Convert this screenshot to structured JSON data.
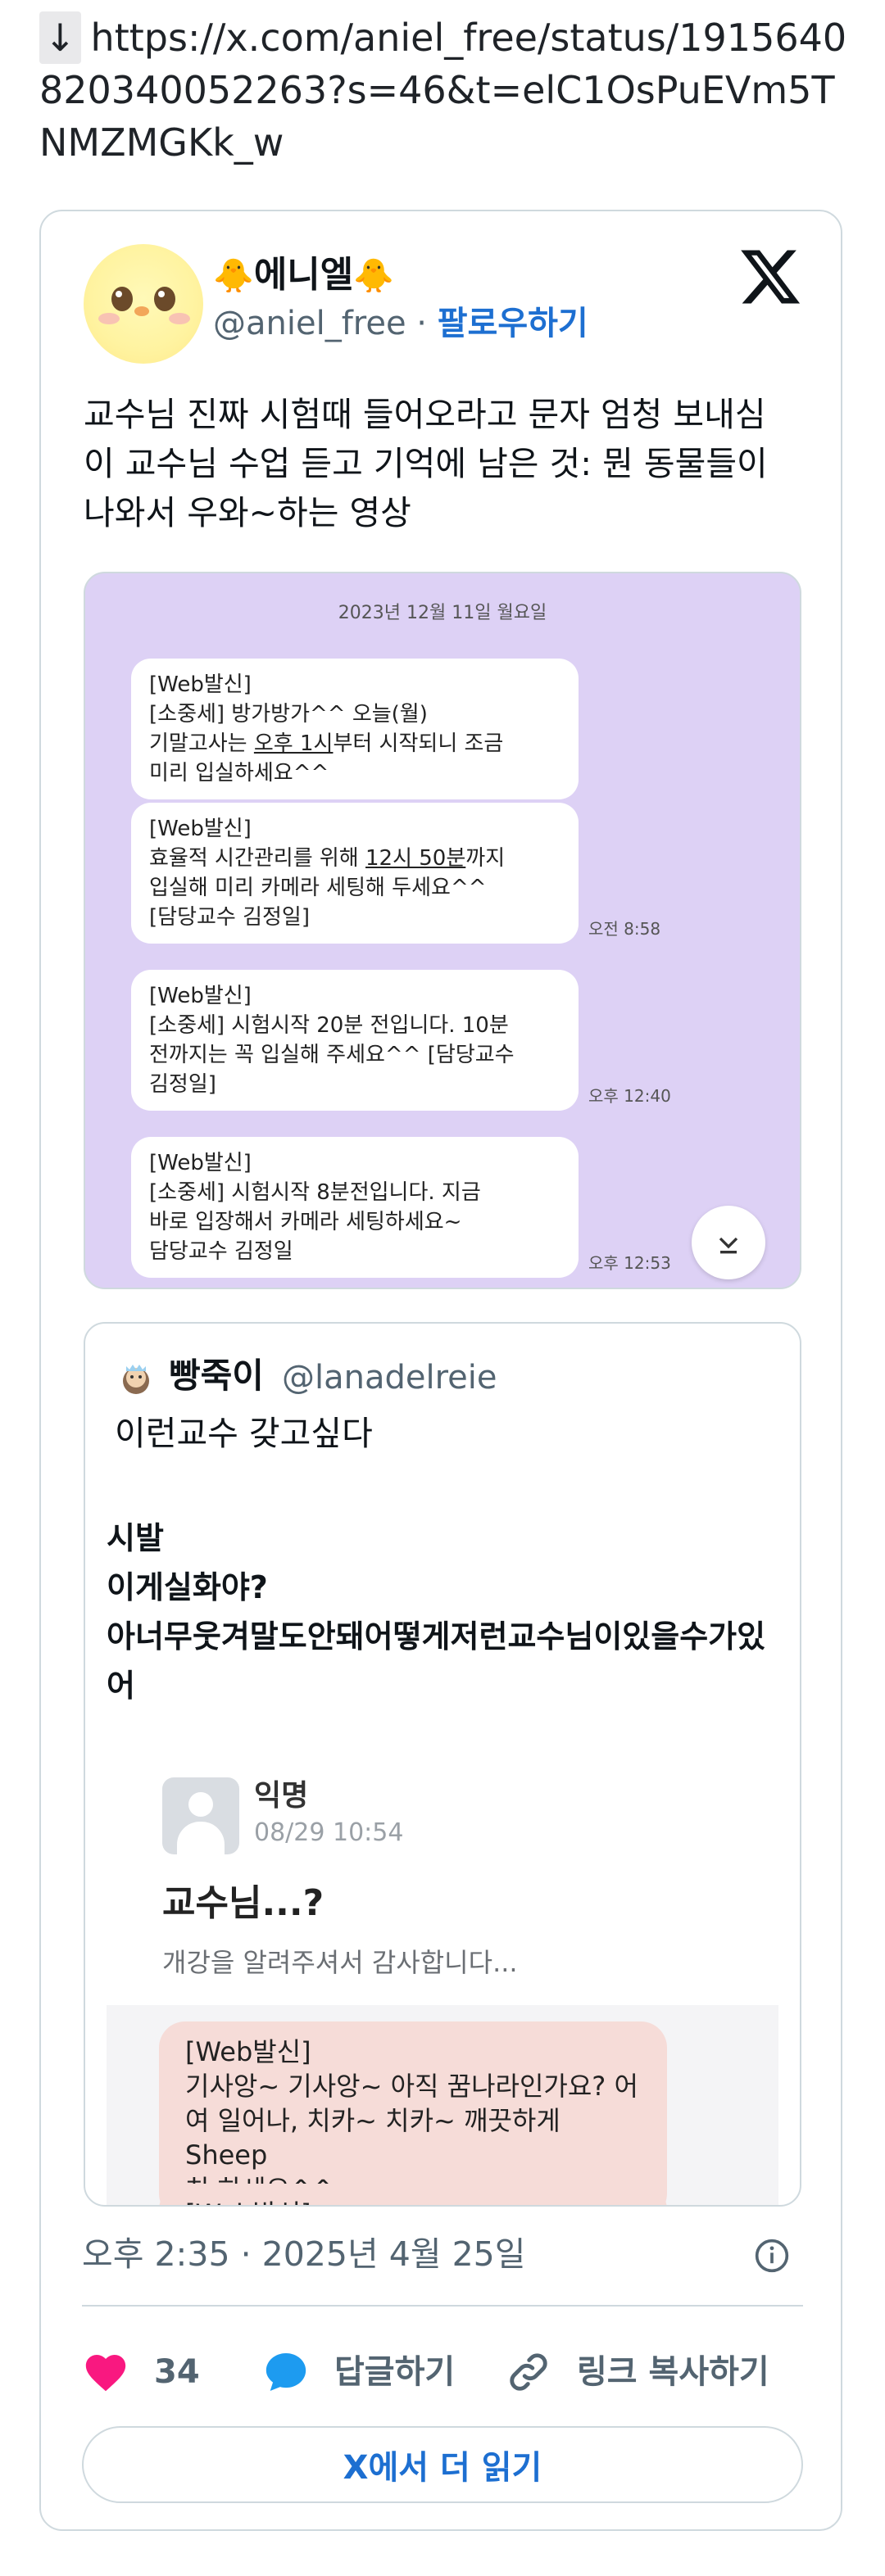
{
  "link": {
    "arrow": "↓",
    "url": "https://x.com/aniel_free/status/1915640820340052263?s=46&t=elC1OsPuEVm5TNMZMGKk_w"
  },
  "tweet": {
    "author": {
      "emoji_left": "🐥",
      "display_name": "에니엘",
      "emoji_right": "🐥",
      "handle": "@aniel_free",
      "separator": "·",
      "follow_label": "팔로우하기"
    },
    "text": "교수님 진짜 시험때 들어오라고 문자 엄청 보내심 이 교수님 수업 듣고 기억에 남은 것: 뭔 동물들이 나와서 우와~하는 영상",
    "media": {
      "date_header": "2023년 12월 11일 월요일",
      "messages": [
        {
          "l1": "[Web발신]",
          "l2": "[소중세]  방가방가^^ 오늘(월)",
          "l3a": "기말고사는 ",
          "l3u": "오후 1시",
          "l3b": "부터 시작되니 조금",
          "l4": "미리 입실하세요^^",
          "time": ""
        },
        {
          "l1": "[Web발신]",
          "l2a": "효율적 시간관리를 위해 ",
          "l2u": "12시 50분",
          "l2b": "까지",
          "l3": "입실해 미리 카메라 세팅해 두세요^^",
          "l4": "[담당교수 김정일]",
          "time": "오전 8:58"
        },
        {
          "l1": "[Web발신]",
          "l2": "[소중세] 시험시작 20분 전입니다. 10분",
          "l3": "전까지는 꼭 입실해 주세요^^ [담당교수",
          "l4": "김정일]",
          "time": "오후 12:40"
        },
        {
          "l1": "[Web발신]",
          "l2": "[소중세] 시험시작 8분전입니다. 지금",
          "l3": "바로 입장해서 카메라 세팅하세요~",
          "l4": "담당교수 김정일",
          "time": "오후 12:53"
        }
      ]
    },
    "quote": {
      "name": "빵죽이",
      "handle": "@lanadelreie",
      "text": "이런교수 갖고싶다",
      "bold_lines": [
        "시발",
        "이게실화야?",
        "아너무웃겨말도안돼어떻게저런교수님이있을수가있",
        "어"
      ],
      "screenshot": {
        "user": "익명",
        "time": "08/29 10:54",
        "title": "교수님...?",
        "subtitle": "개강을 알려주셔서 감사합니다...",
        "chat": [
          {
            "l1": "[Web발신]",
            "l2": "기사앙~ 기사앙~ 아직 꿈나라인가요? 어",
            "l3": "여 일어나, 치카~ 치카~ 깨끗하게 Sheep",
            "l4": "치 하세요^^"
          },
          {
            "l1": "[Web발신]"
          }
        ]
      }
    },
    "timestamp": "오후 2:35 · 2025년 4월 25일",
    "actions": {
      "like_count": "34",
      "reply_label": "답글하기",
      "copy_label": "링크 복사하기"
    },
    "read_more_label": "X에서 더 읽기"
  },
  "colors": {
    "link_blue": "#1d6fd1",
    "like_pink": "#f91880",
    "reply_blue": "#1d9bf0",
    "chat_bg": "#ddd1f5",
    "pink_bubble": "#f6dcd8"
  }
}
